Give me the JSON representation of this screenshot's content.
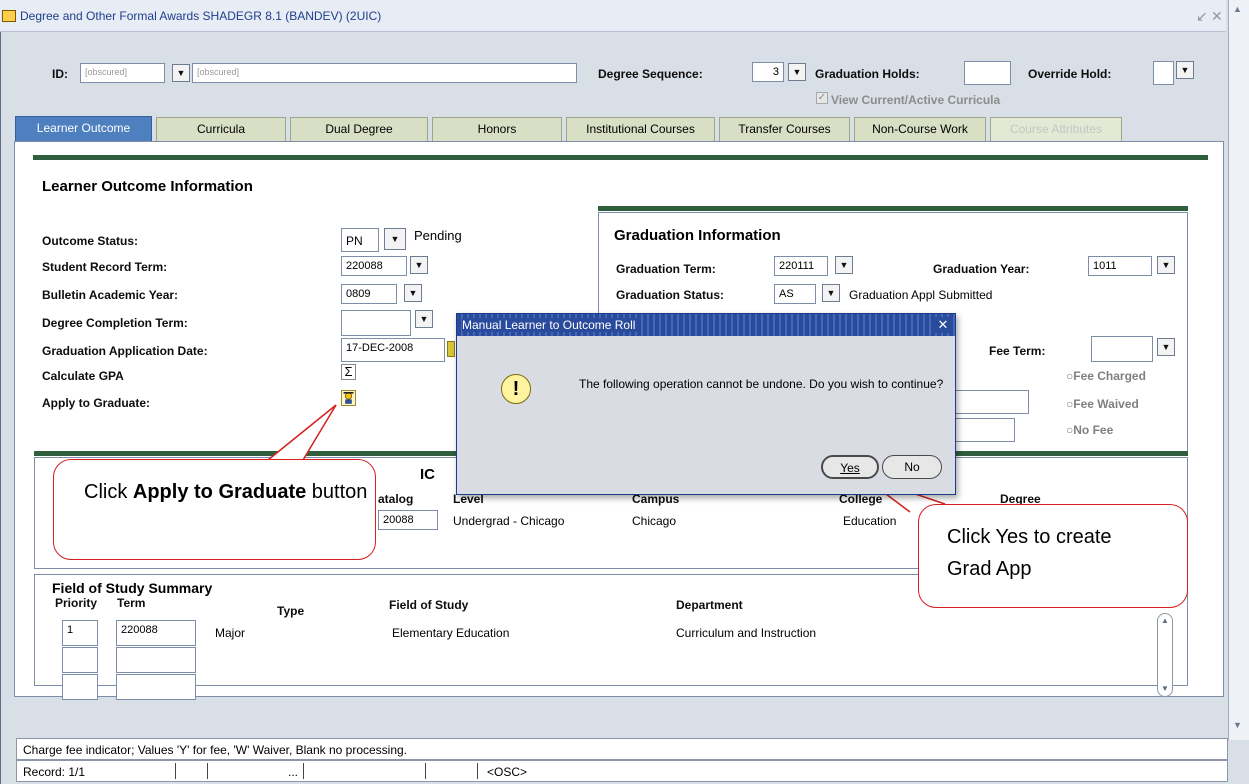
{
  "window": {
    "title": "Degree and Other Formal Awards  SHADEGR  8.1  (BANDEV)  (2UIC)",
    "minimize_glyph": "↙",
    "close_glyph": "✕",
    "scroll_up": "▲",
    "scroll_down": "▼"
  },
  "header": {
    "id_label": "ID:",
    "id_value": "[obscured]",
    "name_value": "[obscured]",
    "degree_sequence_label": "Degree Sequence:",
    "degree_sequence_value": "3",
    "graduation_holds_label": "Graduation Holds:",
    "graduation_holds_value": "",
    "override_hold_label": "Override Hold:",
    "override_hold_value": "",
    "view_curricula_label": "View Current/Active Curricula",
    "view_curricula_checked": true,
    "dropdown_glyph": "▼"
  },
  "tabs": [
    {
      "label": "Learner Outcome",
      "state": "active"
    },
    {
      "label": "Curricula",
      "state": "normal"
    },
    {
      "label": "Dual Degree",
      "state": "normal"
    },
    {
      "label": "Honors",
      "state": "normal"
    },
    {
      "label": "Institutional Courses",
      "state": "normal"
    },
    {
      "label": "Transfer Courses",
      "state": "normal"
    },
    {
      "label": "Non-Course Work",
      "state": "normal"
    },
    {
      "label": "Course Attributes",
      "state": "disabled"
    }
  ],
  "learner_outcome": {
    "section_title": "Learner Outcome Information",
    "outcome_status_label": "Outcome Status:",
    "outcome_status_value": "PN",
    "outcome_status_desc": "Pending",
    "student_record_term_label": "Student Record Term:",
    "student_record_term_value": "220088",
    "bulletin_year_label": "Bulletin Academic Year:",
    "bulletin_year_value": "0809",
    "degree_completion_term_label": "Degree Completion Term:",
    "degree_completion_term_value": "",
    "grad_app_date_label": "Graduation Application Date:",
    "grad_app_date_value": "17-DEC-2008",
    "calculate_gpa_label": "Calculate GPA",
    "calculate_gpa_glyph": "Σ",
    "apply_to_graduate_label": "Apply to Graduate:"
  },
  "graduation_info": {
    "section_title": "Graduation Information",
    "grad_term_label": "Graduation Term:",
    "grad_term_value": "220111",
    "grad_year_label": "Graduation Year:",
    "grad_year_value": "1011",
    "grad_status_label": "Graduation Status:",
    "grad_status_value": "AS",
    "grad_status_desc": "Graduation Appl Submitted",
    "fee_term_label": "Fee Term:",
    "fee_term_value": "",
    "fee_options": [
      "Fee Charged",
      "Fee Waived",
      "No Fee"
    ],
    "radio_glyph": "○"
  },
  "curriculum_summary": {
    "title_fragment": "IC",
    "headers": {
      "catalog": "atalog",
      "level": "Level",
      "campus": "Campus",
      "college": "College",
      "degree": "Degree"
    },
    "row": {
      "catalog": "20088",
      "level": "Undergrad - Chicago",
      "campus": "Chicago",
      "college": "Education"
    }
  },
  "field_of_study": {
    "title": "Field of Study Summary",
    "headers": {
      "priority": "Priority",
      "term": "Term",
      "type": "Type",
      "field": "Field of Study",
      "department": "Department"
    },
    "rows": [
      {
        "priority": "1",
        "term": "220088",
        "type": "Major",
        "field": "Elementary Education",
        "department": "Curriculum and Instruction"
      },
      {
        "priority": "",
        "term": "",
        "type": "",
        "field": "",
        "department": ""
      },
      {
        "priority": "",
        "term": "",
        "type": "",
        "field": "",
        "department": ""
      }
    ],
    "scroll_up": "▲",
    "scroll_down": "▼"
  },
  "dialog": {
    "title": "Manual Learner to Outcome Roll",
    "close_glyph": "✕",
    "message": "The following operation cannot be undone. Do you wish to continue?",
    "warning_glyph": "!",
    "yes_label": "Yes",
    "no_label": "No"
  },
  "callouts": {
    "apply_prefix": "Click ",
    "apply_bold": "Apply to Graduate",
    "apply_suffix": " button",
    "yes_text": "Click Yes to create Grad App"
  },
  "status": {
    "hint": "Charge fee indicator; Values 'Y' for fee, 'W' Waiver, Blank no processing.",
    "record": "Record: 1/1",
    "ellipsis": "...",
    "osc": "<OSC>"
  },
  "colors": {
    "active_tab": "#4e7fbf",
    "tab_bg": "#d8dfc4",
    "green_bar": "#2f5f3c",
    "dialog_title": "#2a4a9c",
    "callout_border": "#d62020"
  }
}
